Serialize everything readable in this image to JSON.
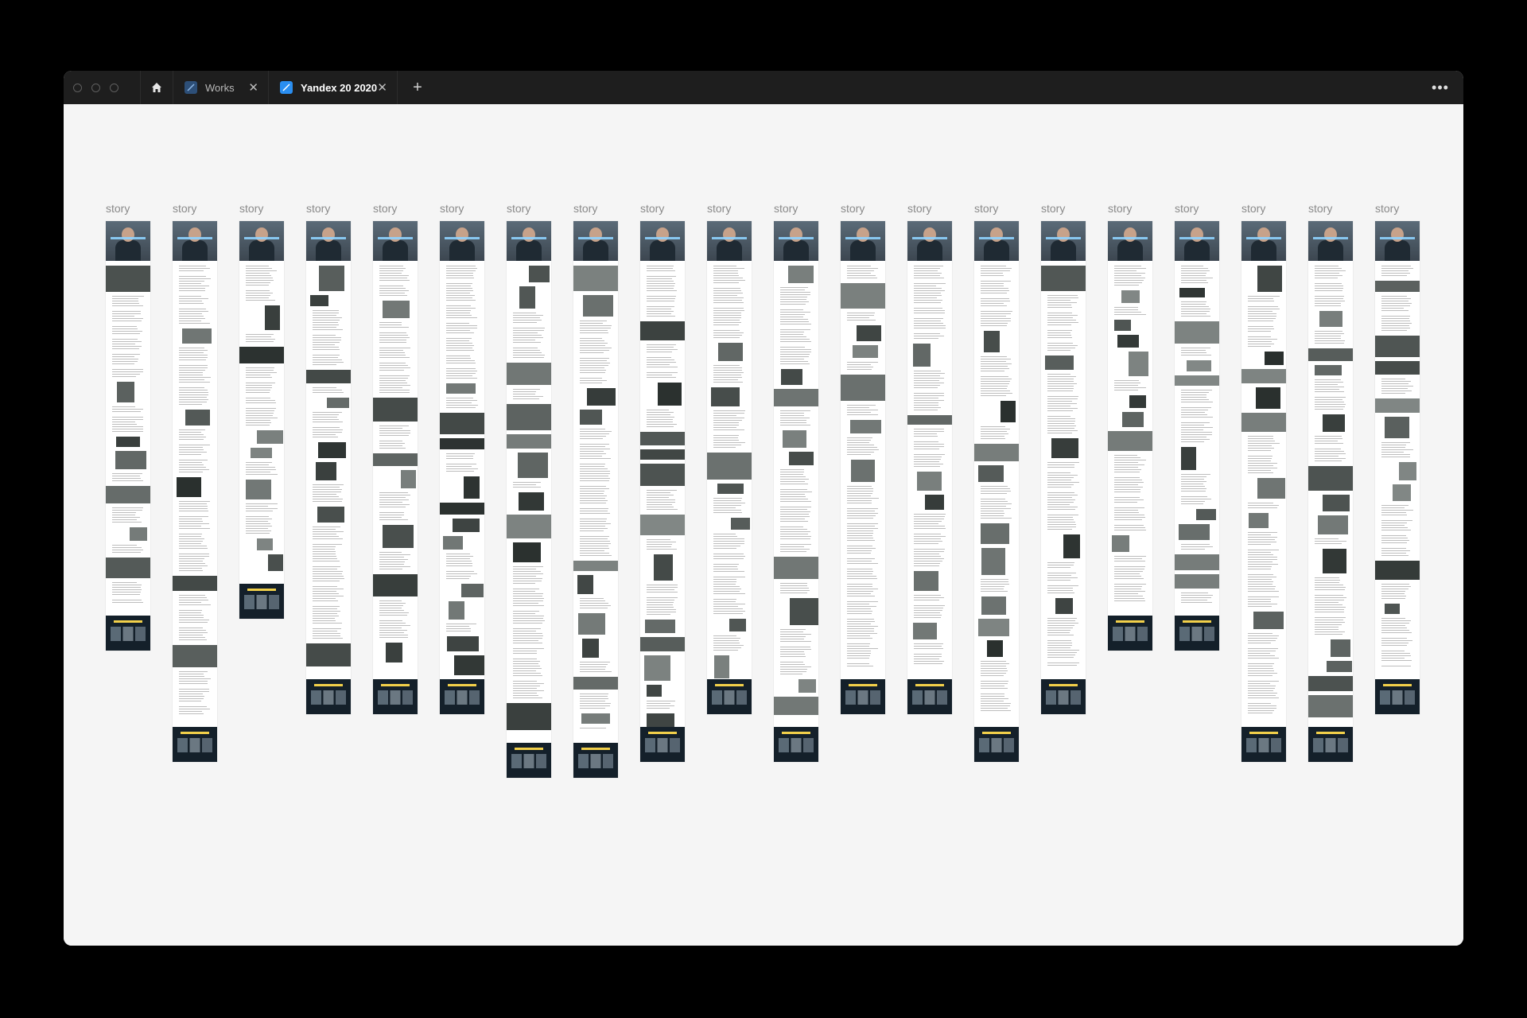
{
  "tabs": [
    {
      "label": "Works",
      "active": false
    },
    {
      "label": "Yandex 20 2020",
      "active": true
    }
  ],
  "frames": [
    {
      "label": "story",
      "length": "short"
    },
    {
      "label": "story",
      "length": "long"
    },
    {
      "label": "story",
      "length": "shortest"
    },
    {
      "label": "story",
      "length": "medium"
    },
    {
      "label": "story",
      "length": "medium"
    },
    {
      "label": "story",
      "length": "medium"
    },
    {
      "label": "story",
      "length": "longest"
    },
    {
      "label": "story",
      "length": "longest"
    },
    {
      "label": "story",
      "length": "long"
    },
    {
      "label": "story",
      "length": "medium"
    },
    {
      "label": "story",
      "length": "long"
    },
    {
      "label": "story",
      "length": "medium"
    },
    {
      "label": "story",
      "length": "medium"
    },
    {
      "label": "story",
      "length": "long"
    },
    {
      "label": "story",
      "length": "medium"
    },
    {
      "label": "story",
      "length": "short"
    },
    {
      "label": "story",
      "length": "short"
    },
    {
      "label": "story",
      "length": "long"
    },
    {
      "label": "story",
      "length": "long"
    },
    {
      "label": "story",
      "length": "medium"
    }
  ],
  "colors": {
    "titlebar": "#1e1e1e",
    "canvas": "#f5f5f5",
    "file_icon": "#2a8ef0",
    "accent_yellow": "#f2d04a"
  },
  "icons": {
    "home": "home-icon",
    "file": "figma-file-icon",
    "close": "close-icon",
    "add": "plus-icon",
    "more": "more-icon"
  }
}
